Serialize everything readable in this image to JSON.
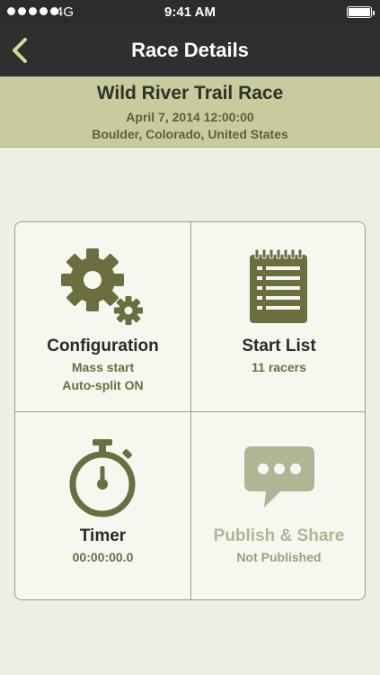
{
  "status_bar": {
    "carrier": "4G",
    "time": "9:41 AM"
  },
  "nav": {
    "title": "Race Details",
    "back_icon": "chevron-left-icon"
  },
  "race": {
    "name": "Wild River Trail Race",
    "date": "April 7, 2014 12:00:00",
    "location": "Boulder, Colorado, United States"
  },
  "tiles": {
    "configuration": {
      "title": "Configuration",
      "line1": "Mass start",
      "line2": "Auto-split ON",
      "icon": "gears-icon"
    },
    "start_list": {
      "title": "Start List",
      "line1": "11 racers",
      "icon": "notepad-list-icon"
    },
    "timer": {
      "title": "Timer",
      "line1": "00:00:00.0",
      "icon": "stopwatch-icon"
    },
    "publish": {
      "title": "Publish & Share",
      "line1": "Not Published",
      "icon": "chat-bubble-icon"
    }
  },
  "colors": {
    "accent_olive": "#6b6e3f",
    "header_band": "#c9cb9f",
    "nav_bar": "#2f2f2f",
    "background": "#eeeee2",
    "disabled_gray": "#b2b594"
  }
}
